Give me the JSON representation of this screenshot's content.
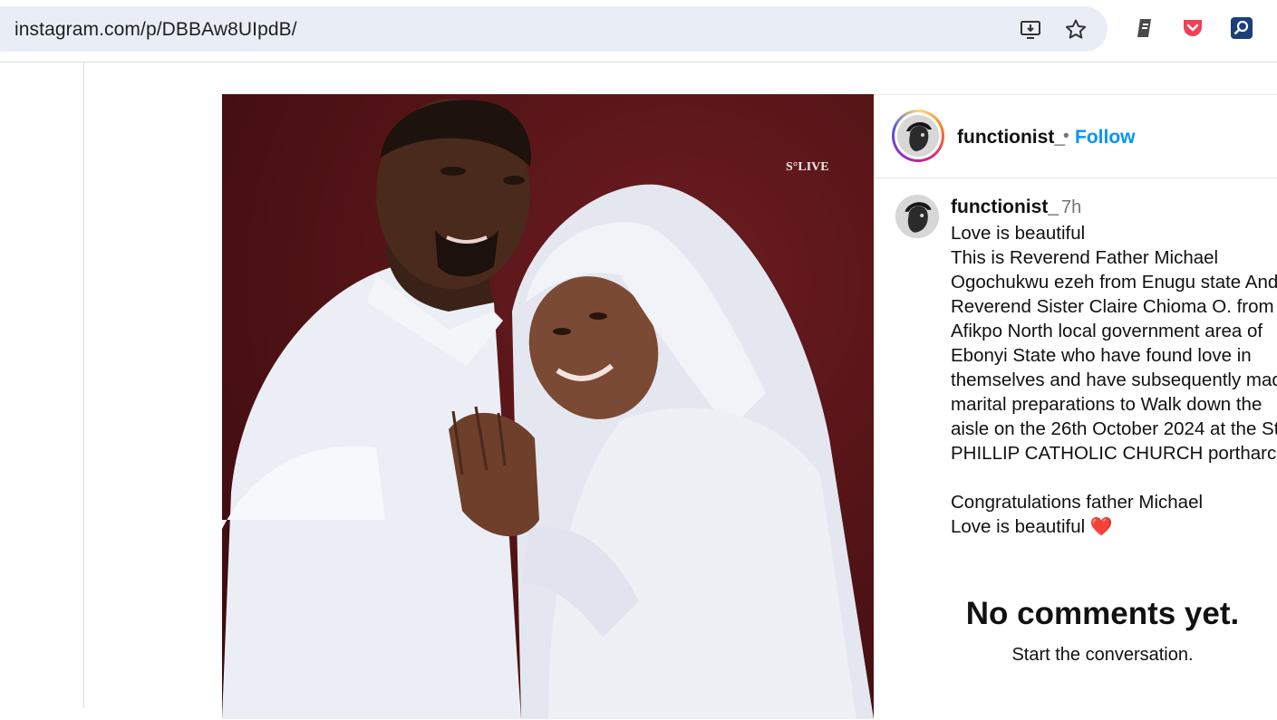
{
  "browser": {
    "url": "instagram.com/p/DBBAw8UIpdB/",
    "icons": [
      "install-app-icon",
      "bookmark-star-icon",
      "extension-script-icon",
      "pocket-icon",
      "search-extension-icon"
    ]
  },
  "post": {
    "photo_watermark": "S°LIVE",
    "header": {
      "username": "functionist_",
      "separator": "•",
      "follow_label": "Follow"
    },
    "caption": {
      "username": "functionist_",
      "time": "7h",
      "lines": [
        "Love is beautiful",
        "This is Reverend Father Michael",
        "Ogochukwu ezeh from Enugu state And",
        "Reverend Sister Claire Chioma O. from",
        "Afikpo North local government area of",
        "Ebonyi State who have found love in",
        "themselves and have subsequently made",
        "marital preparations to Walk down the",
        "aisle on the 26th October 2024 at the St",
        "PHILLIP CATHOLIC CHURCH portharcourt",
        "",
        "Congratulations father Michael",
        "Love is beautiful"
      ],
      "emoji": "❤️"
    },
    "comments": {
      "empty_title": "No comments yet.",
      "empty_subtitle": "Start the conversation."
    }
  },
  "colors": {
    "accent": "#0095f6",
    "omnibox": "#e9eef6",
    "photo_background": "#5a1418"
  }
}
